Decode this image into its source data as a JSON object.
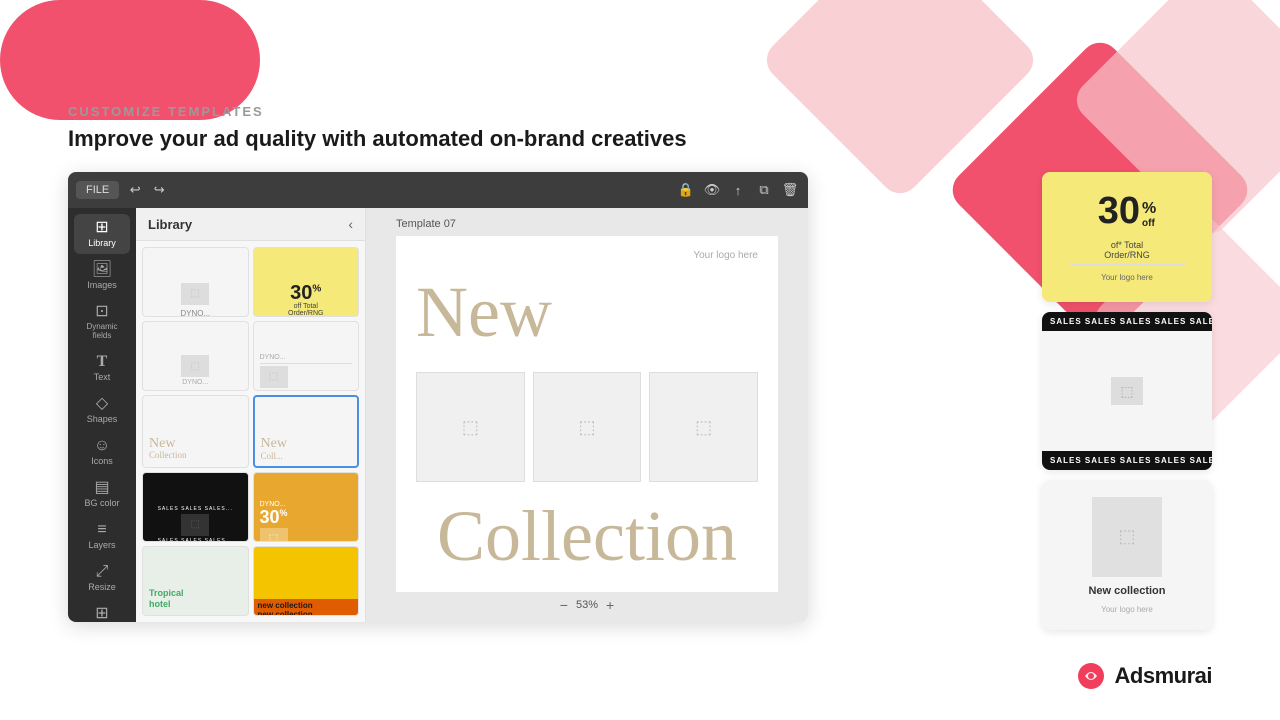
{
  "page": {
    "label": "CUSTOMIZE TEMPLATES",
    "heading": "Improve your ad quality with automated on-brand creatives"
  },
  "editor": {
    "toolbar": {
      "file_button": "FILE",
      "template_name": "Template 07"
    },
    "sidebar_icons": [
      {
        "id": "library",
        "label": "Library",
        "symbol": "⬛",
        "active": true
      },
      {
        "id": "images",
        "label": "Images",
        "symbol": "🖼"
      },
      {
        "id": "dynamic",
        "label": "Dynamic\nfields",
        "symbol": "⊞"
      },
      {
        "id": "text",
        "label": "Text",
        "symbol": "T"
      },
      {
        "id": "shapes",
        "label": "Shapes",
        "symbol": "◇"
      },
      {
        "id": "icons",
        "label": "Icons",
        "symbol": "☺"
      },
      {
        "id": "bg-color",
        "label": "BG color",
        "symbol": "▤"
      },
      {
        "id": "layers",
        "label": "Layers",
        "symbol": "≡"
      },
      {
        "id": "resize",
        "label": "Resize",
        "symbol": "⤢"
      },
      {
        "id": "grid",
        "label": "Grid",
        "symbol": "⊞"
      }
    ],
    "library": {
      "title": "Library"
    },
    "canvas": {
      "title": "Template 07",
      "logo_placeholder": "Your logo here",
      "new_text": "New",
      "collection_text": "Collection",
      "zoom_level": "53%"
    }
  },
  "right_panel": {
    "card1": {
      "discount_number": "30",
      "discount_sup": "%",
      "off_text": "off",
      "subtitle": "of* Total\nOrder/RNG",
      "logo_placeholder": "Your logo here"
    },
    "card2": {
      "sales_text": "SALES SALES SALES SALES SALES",
      "sales_text_bottom": "SALES SALES SALES SALES SALES"
    },
    "card3": {
      "label": "New collection",
      "sub_label": "Your logo here"
    }
  },
  "adsmurai": {
    "name": "Adsmurai"
  },
  "colors": {
    "coral": "#f03e5c",
    "pink_light": "#f7c5cb",
    "yellow": "#f5e97a",
    "dark": "#1a1a1a",
    "text_gray": "#9a9a9a"
  }
}
